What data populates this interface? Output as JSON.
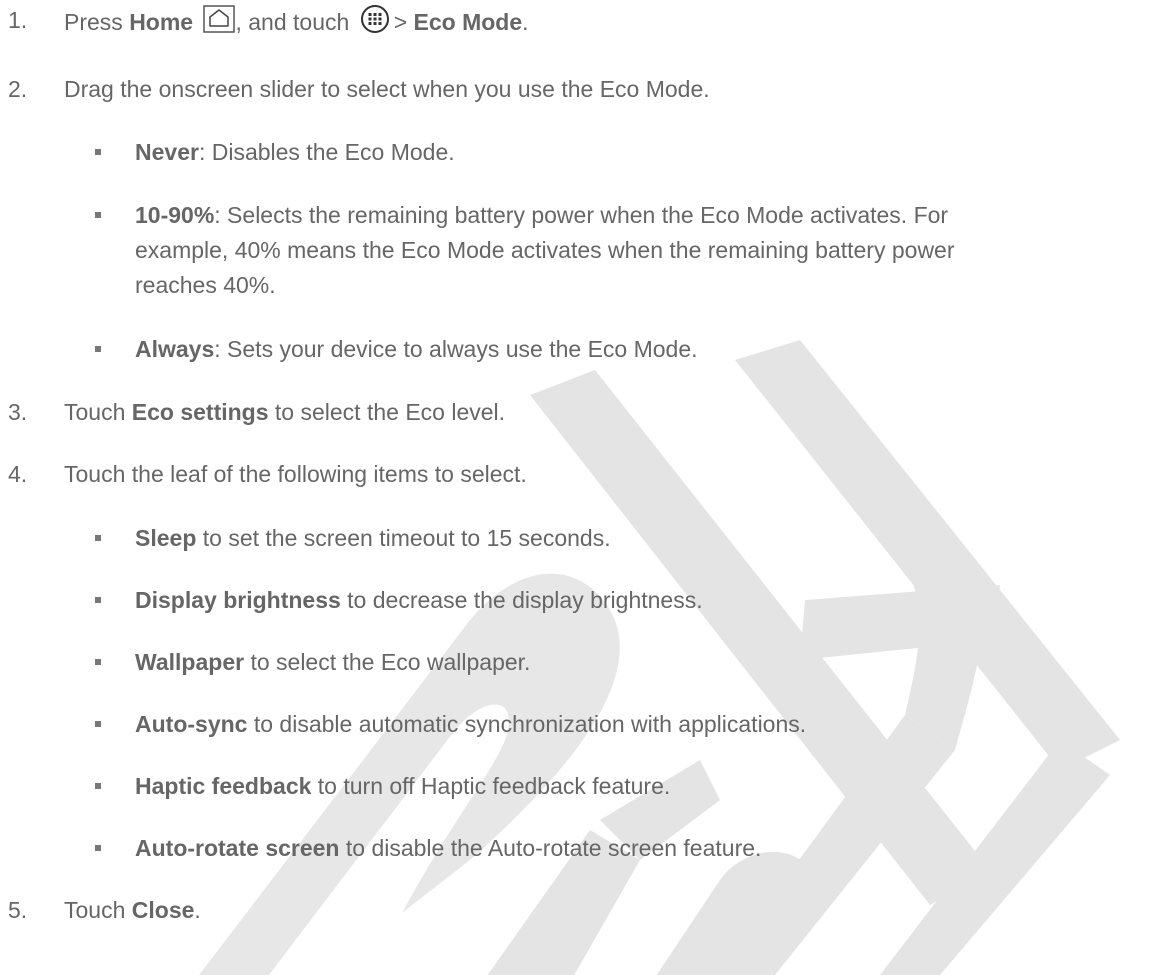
{
  "watermark": "Draft",
  "steps": [
    {
      "num": "1.",
      "parts": [
        "Press ",
        "Home",
        ", and touch ",
        "> ",
        "Eco Mode",
        "."
      ]
    },
    {
      "num": "2.",
      "text": "Drag the onscreen slider to select when you use the Eco Mode.",
      "bullets": [
        {
          "bold": "Never",
          "rest": ": Disables the Eco Mode."
        },
        {
          "bold": "10-90%",
          "rest": ": Selects the remaining battery power when the Eco Mode activates. For",
          "cont": [
            "example, 40% means the Eco Mode activates when the remaining battery power",
            "reaches 40%."
          ]
        },
        {
          "bold": "Always",
          "rest": ": Sets your device to always use the Eco Mode."
        }
      ]
    },
    {
      "num": "3.",
      "pre": "Touch ",
      "bold": "Eco settings",
      "rest": " to select the Eco level."
    },
    {
      "num": "4.",
      "text": "Touch the leaf of the following items to select.",
      "bullets": [
        {
          "bold": "Sleep",
          "rest": " to set the screen timeout to 15 seconds."
        },
        {
          "bold": "Display brightness",
          "rest": " to decrease the display brightness."
        },
        {
          "bold": "Wallpaper",
          "rest": " to select the Eco wallpaper."
        },
        {
          "bold": "Auto-sync",
          "rest": " to disable automatic synchronization with applications."
        },
        {
          "bold": "Haptic feedback",
          "rest": " to turn off Haptic feedback feature."
        },
        {
          "bold": "Auto-rotate screen",
          "rest": " to disable the Auto-rotate screen feature."
        }
      ]
    },
    {
      "num": "5.",
      "pre": "Touch ",
      "bold": "Close",
      "rest": "."
    }
  ],
  "icons": {
    "home": "home-icon",
    "apps": "apps-grid-icon"
  }
}
